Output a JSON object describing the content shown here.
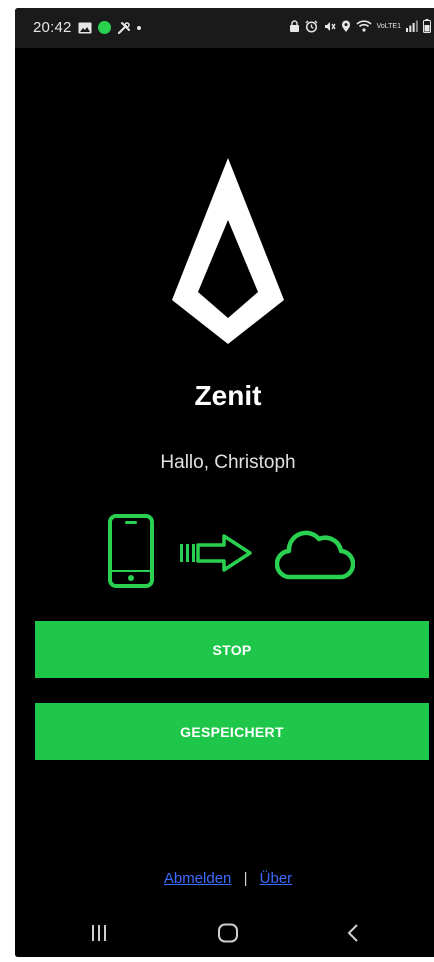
{
  "status_bar": {
    "time": "20:42",
    "left_icons": [
      "image-icon",
      "green-dot-icon",
      "tools-icon",
      "dot-icon"
    ],
    "right_icons": [
      "lock-icon",
      "alarm-icon",
      "mute-icon",
      "location-icon",
      "wifi-icon",
      "volte-icon",
      "signal-icon",
      "battery-icon"
    ],
    "network_label": "VoLTE1"
  },
  "app": {
    "title": "Zenit",
    "greeting": "Hallo, Christoph"
  },
  "sync": {
    "icons": [
      "phone-icon",
      "arrow-right-icon",
      "cloud-icon"
    ]
  },
  "buttons": {
    "stop_label": "STOP",
    "saved_label": "GESPEICHERT"
  },
  "footer": {
    "logout_label": "Abmelden",
    "separator": "|",
    "about_label": "Über"
  },
  "nav": {
    "items": [
      "recent-apps-icon",
      "home-icon",
      "back-icon"
    ]
  },
  "colors": {
    "background": "#000000",
    "accent_green": "#1ec74a",
    "icon_green": "#2ad04f",
    "link_blue": "#3d6bff",
    "text_white": "#ffffff",
    "statusbar_bg": "#1a1a1a"
  }
}
